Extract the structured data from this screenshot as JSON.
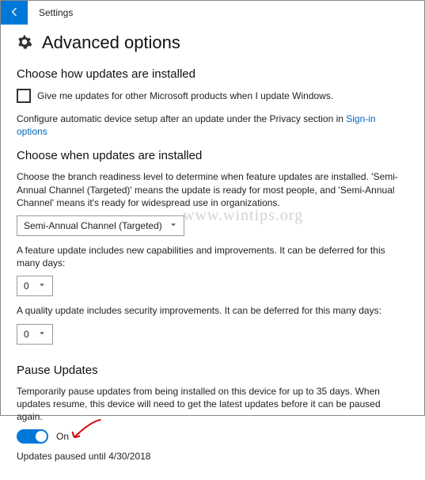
{
  "titlebar": {
    "title": "Settings"
  },
  "page": {
    "heading": "Advanced options"
  },
  "section1": {
    "title": "Choose how updates are installed",
    "checkbox_label": "Give me updates for other Microsoft products when I update Windows.",
    "config_text_prefix": "Configure automatic device setup after an update under the Privacy section in ",
    "config_link": "Sign-in options"
  },
  "section2": {
    "title": "Choose when updates are installed",
    "desc": "Choose the branch readiness level to determine when feature updates are installed. 'Semi-Annual Channel (Targeted)' means the update is ready for most people, and 'Semi-Annual Channel' means it's ready for widespread use in organizations.",
    "branch_value": "Semi-Annual Channel (Targeted)",
    "feature_text": "A feature update includes new capabilities and improvements. It can be deferred for this many days:",
    "feature_days": "0",
    "quality_text": "A quality update includes security improvements. It can be deferred for this many days:",
    "quality_days": "0"
  },
  "section3": {
    "title": "Pause Updates",
    "desc": "Temporarily pause updates from being installed on this device for up to 35 days. When updates resume, this device will need to get the latest updates before it can be paused again.",
    "toggle_state": "On",
    "paused_until": "Updates paused until  4/30/2018"
  },
  "watermark": "www.wintips.org"
}
